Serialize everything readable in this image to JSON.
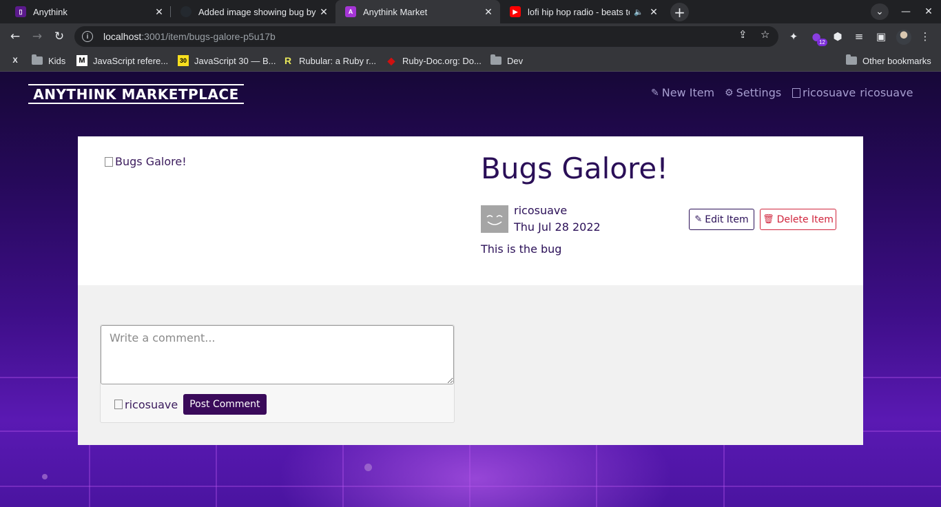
{
  "tabs": [
    {
      "title": "Anythink",
      "favicon_color": "#5b1a8c"
    },
    {
      "title": "Added image showing bug by ric",
      "favicon_color": "#24292f"
    },
    {
      "title": "Anythink Market",
      "favicon_color": "#a535d6"
    },
    {
      "title": "lofi hip hop radio - beats to rel",
      "favicon_color": "#ff0000"
    }
  ],
  "address": {
    "host": "localhost",
    "path": ":3001/item/bugs-galore-p5u17b"
  },
  "bookmarks": [
    {
      "label": "",
      "icon": "X"
    },
    {
      "label": "Kids",
      "icon": "folder-icon"
    },
    {
      "label": "JavaScript refere...",
      "icon": "M"
    },
    {
      "label": "JavaScript 30 — B...",
      "icon": "30"
    },
    {
      "label": "Rubular: a Ruby r...",
      "icon": "R"
    },
    {
      "label": "Ruby-Doc.org: Do...",
      "icon": "ruby-gem-icon"
    },
    {
      "label": "Dev",
      "icon": "folder-icon"
    },
    {
      "label": "Other bookmarks",
      "icon": "folder-icon"
    }
  ],
  "extensions_badge": "12",
  "site": {
    "brand": "ANYTHINK MARKETPLACE",
    "nav": {
      "new_item": "New Item",
      "settings": "Settings",
      "user_alt": "ricosuave",
      "user": "ricosuave"
    }
  },
  "item": {
    "image_alt": "Bugs Galore!",
    "title": "Bugs Galore!",
    "author": "ricosuave",
    "date": "Thu Jul 28 2022",
    "description": "This is the bug",
    "edit_label": "Edit Item",
    "delete_label": "Delete Item"
  },
  "comments": {
    "placeholder": "Write a comment...",
    "avatar_alt": "ricosuave",
    "post_label": "Post Comment"
  },
  "colors": {
    "brand_dark": "#2a0f57",
    "danger": "#d0243c",
    "accent": "#3a0a5a"
  }
}
